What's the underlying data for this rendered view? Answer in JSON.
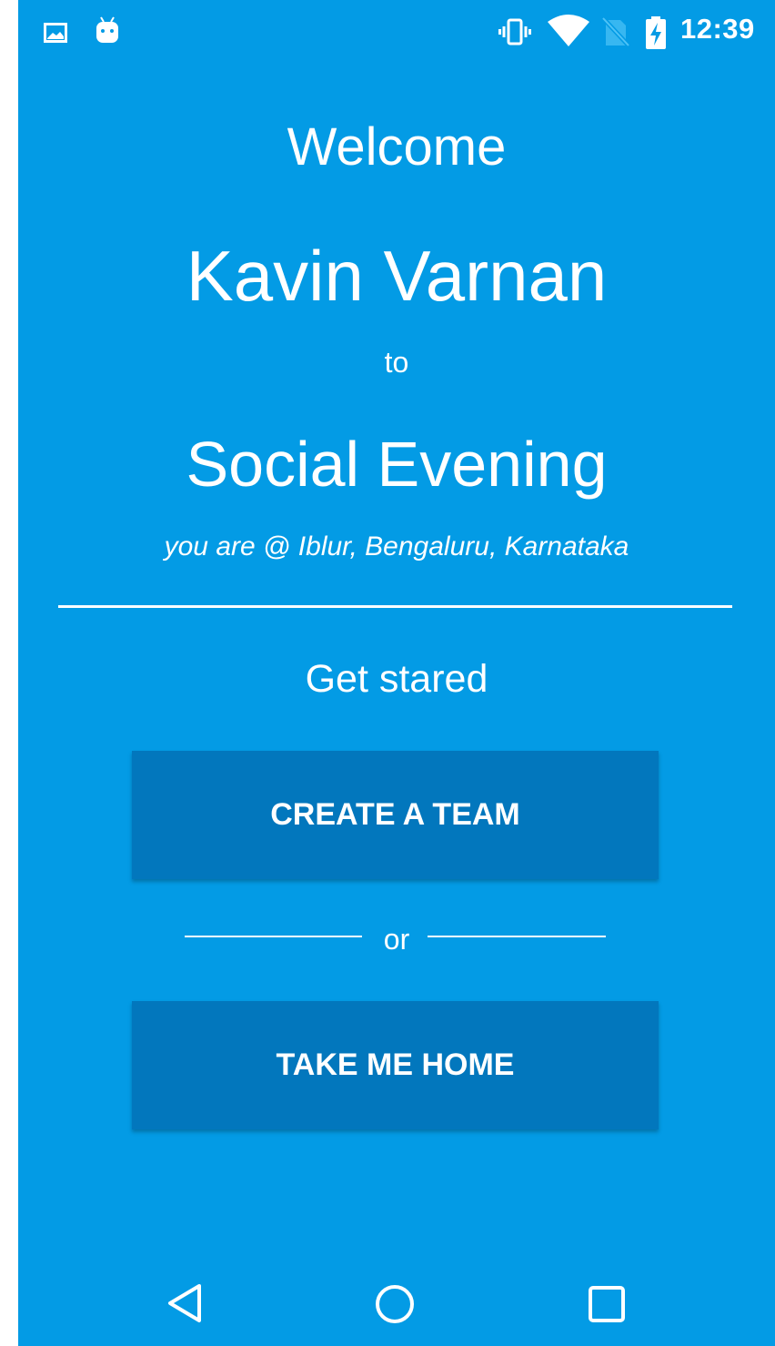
{
  "status_bar": {
    "time": "12:39",
    "icons": [
      "image-icon",
      "android-icon",
      "vibrate-icon",
      "wifi-icon",
      "no-sim-icon",
      "battery-charging-icon"
    ]
  },
  "welcome": {
    "greeting": "Welcome",
    "user_name": "Kavin Varnan",
    "connector": "to",
    "event_name": "Social Evening",
    "location": "you are @ Iblur, Bengaluru, Karnataka"
  },
  "actions": {
    "heading": "Get stared",
    "create_team_label": "CREATE A TEAM",
    "separator_text": "or",
    "take_home_label": "TAKE ME HOME"
  },
  "nav_bar": {
    "icons": [
      "back-icon",
      "home-icon",
      "recents-icon"
    ]
  },
  "colors": {
    "background": "#039be5",
    "button": "#0277bd",
    "text": "#ffffff"
  }
}
